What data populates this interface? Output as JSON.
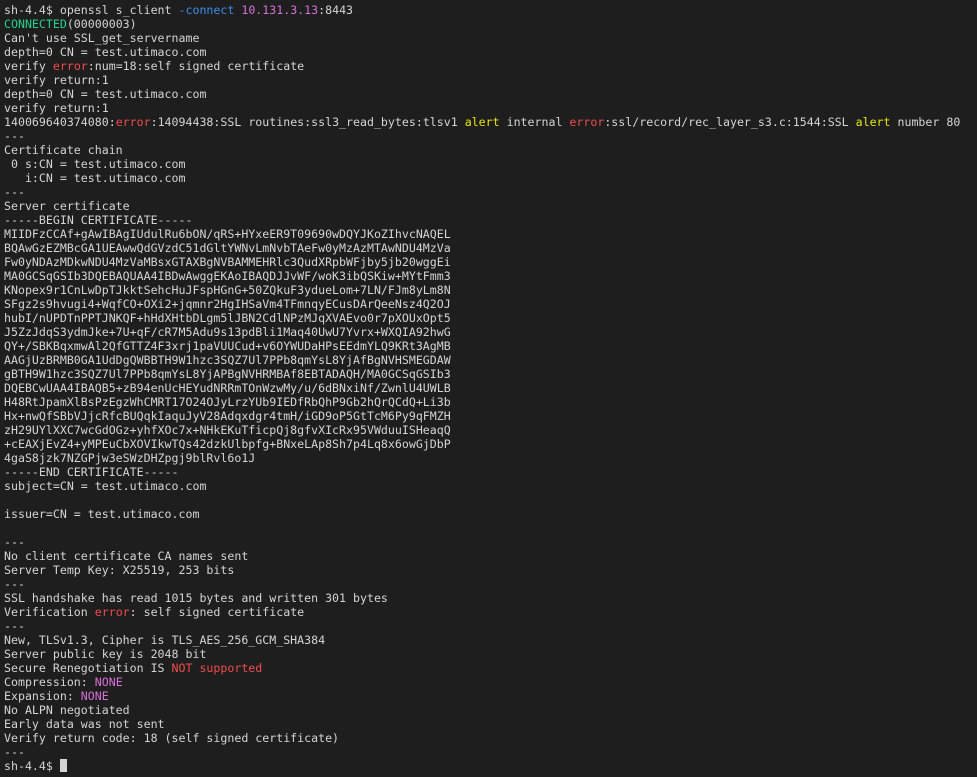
{
  "terminal": {
    "colors": {
      "background": "#1e1e1e",
      "default": "#d4d4d4",
      "green": "#23d18b",
      "red": "#f14c4c",
      "yellow": "#e5e510",
      "magenta": "#d670d6",
      "blue": "#3b8eea"
    },
    "lines": [
      [
        {
          "t": "sh-4.4$ openssl s_client "
        },
        {
          "t": "-connect",
          "c": "blue"
        },
        {
          "t": " "
        },
        {
          "t": "10.131.3.13",
          "c": "magenta"
        },
        {
          "t": ":8443"
        }
      ],
      [
        {
          "t": "CONNECTED",
          "c": "green"
        },
        {
          "t": "(00000003)"
        }
      ],
      [
        {
          "t": "Can't use SSL_get_servername"
        }
      ],
      [
        {
          "t": "depth=0 CN = test.utimaco.com"
        }
      ],
      [
        {
          "t": "verify "
        },
        {
          "t": "error",
          "c": "red"
        },
        {
          "t": ":num=18:self signed certificate"
        }
      ],
      [
        {
          "t": "verify return:1"
        }
      ],
      [
        {
          "t": "depth=0 CN = test.utimaco.com"
        }
      ],
      [
        {
          "t": "verify return:1"
        }
      ],
      [
        {
          "t": "140069640374080:"
        },
        {
          "t": "error",
          "c": "red"
        },
        {
          "t": ":14094438:SSL routines:ssl3_read_bytes:tlsv1 "
        },
        {
          "t": "alert",
          "c": "yellow"
        },
        {
          "t": " internal "
        },
        {
          "t": "error",
          "c": "red"
        },
        {
          "t": ":ssl/record/rec_layer_s3.c:1544:SSL "
        },
        {
          "t": "alert",
          "c": "yellow"
        },
        {
          "t": " number 80"
        }
      ],
      [
        {
          "t": "---"
        }
      ],
      [
        {
          "t": "Certificate chain"
        }
      ],
      [
        {
          "t": " 0 s:CN = test.utimaco.com"
        }
      ],
      [
        {
          "t": "   i:CN = test.utimaco.com"
        }
      ],
      [
        {
          "t": "---"
        }
      ],
      [
        {
          "t": "Server certificate"
        }
      ],
      [
        {
          "t": "-----BEGIN CERTIFICATE-----"
        }
      ],
      [
        {
          "t": "MIIDFzCCAf+gAwIBAgIUdulRu6bON/qRS+HYxeER9T09690wDQYJKoZIhvcNAQEL"
        }
      ],
      [
        {
          "t": "BQAwGzEZMBcGA1UEAwwQdGVzdC51dGltYWNvLmNvbTAeFw0yMzAzMTAwNDU4MzVa"
        }
      ],
      [
        {
          "t": "Fw0yNDAzMDkwNDU4MzVaMBsxGTAXBgNVBAMMEHRlc3QudXRpbWFjby5jb20wggEi"
        }
      ],
      [
        {
          "t": "MA0GCSqGSIb3DQEBAQUAA4IBDwAwggEKAoIBAQDJJvWF/woK3ibQSKiw+MYtFmm3"
        }
      ],
      [
        {
          "t": "KNopex9r1CnLwDpTJkktSehcHuJFspHGnG+50ZQkuF3ydueLom+7LN/FJm8yLm8N"
        }
      ],
      [
        {
          "t": "SFgz2s9hvugi4+WqfCO+OXi2+jqmnr2HgIHSaVm4TFmnqyECusDArQeeNsz4Q2OJ"
        }
      ],
      [
        {
          "t": "hubI/nUPDTnPPTJNKQF+hHdXHtbDLgm5lJBN2CdlNPzMJqXVAEvo0r7pXOUxOpt5"
        }
      ],
      [
        {
          "t": "J5ZzJdqS3ydmJke+7U+qF/cR7M5Adu9s13pdBli1Maq40UwU7Yvrx+WXQIA92hwG"
        }
      ],
      [
        {
          "t": "QY+/SBKBqxmwAl2QfGTTZ4F3xrj1paVUUCud+v6OYWUDaHPsEEdmYLQ9KRt3AgMB"
        }
      ],
      [
        {
          "t": "AAGjUzBRMB0GA1UdDgQWBBTH9W1hzc3SQZ7Ul7PPb8qmYsL8YjAfBgNVHSMEGDAW"
        }
      ],
      [
        {
          "t": "gBTH9W1hzc3SQZ7Ul7PPb8qmYsL8YjAPBgNVHRMBAf8EBTADAQH/MA0GCSqGSIb3"
        }
      ],
      [
        {
          "t": "DQEBCwUAA4IBAQB5+zB94enUcHEYudNRRmTOnWzwMy/u/6dBNxiNf/ZwnlU4UWLB"
        }
      ],
      [
        {
          "t": "H48RtJpamXlBsPzEgzWhCMRT17O24OJyLrzYUb9IEDfRbQhP9Gb2hQrQCdQ+Li3b"
        }
      ],
      [
        {
          "t": "Hx+nwQfSBbVJjcRfcBUQqkIaquJyV28Adqxdgr4tmH/iGD9oP5GtTcM6Py9qFMZH"
        }
      ],
      [
        {
          "t": "zH29UYlXXC7wcGdOGz+yhfXOc7x+NHkEKuTficpQj8gfvXIcRx95VWduuISHeaqQ"
        }
      ],
      [
        {
          "t": "+cEAXjEvZ4+yMPEuCbXOVIkwTQs42dzkUlbpfg+BNxeLAp8Sh7p4Lq8x6owGjDbP"
        }
      ],
      [
        {
          "t": "4gaS8jzk7NZGPjw3eSWzDHZpgj9blRvl6o1J"
        }
      ],
      [
        {
          "t": "-----END CERTIFICATE-----"
        }
      ],
      [
        {
          "t": "subject=CN = test.utimaco.com"
        }
      ],
      [
        {
          "t": ""
        }
      ],
      [
        {
          "t": "issuer=CN = test.utimaco.com"
        }
      ],
      [
        {
          "t": ""
        }
      ],
      [
        {
          "t": "---"
        }
      ],
      [
        {
          "t": "No client certificate CA names sent"
        }
      ],
      [
        {
          "t": "Server Temp Key: X25519, 253 bits"
        }
      ],
      [
        {
          "t": "---"
        }
      ],
      [
        {
          "t": "SSL handshake has read 1015 bytes and written 301 bytes"
        }
      ],
      [
        {
          "t": "Verification "
        },
        {
          "t": "error",
          "c": "red"
        },
        {
          "t": ": self signed certificate"
        }
      ],
      [
        {
          "t": "---"
        }
      ],
      [
        {
          "t": "New, TLSv1.3, Cipher is TLS_AES_256_GCM_SHA384"
        }
      ],
      [
        {
          "t": "Server public key is 2048 bit"
        }
      ],
      [
        {
          "t": "Secure Renegotiation IS "
        },
        {
          "t": "NOT supported",
          "c": "red"
        }
      ],
      [
        {
          "t": "Compression: "
        },
        {
          "t": "NONE",
          "c": "magenta"
        }
      ],
      [
        {
          "t": "Expansion: "
        },
        {
          "t": "NONE",
          "c": "magenta"
        }
      ],
      [
        {
          "t": "No ALPN negotiated"
        }
      ],
      [
        {
          "t": "Early data was not sent"
        }
      ],
      [
        {
          "t": "Verify return code: 18 (self signed certificate)"
        }
      ],
      [
        {
          "t": "---"
        }
      ],
      [
        {
          "t": "sh-4.4$ "
        }
      ]
    ]
  }
}
